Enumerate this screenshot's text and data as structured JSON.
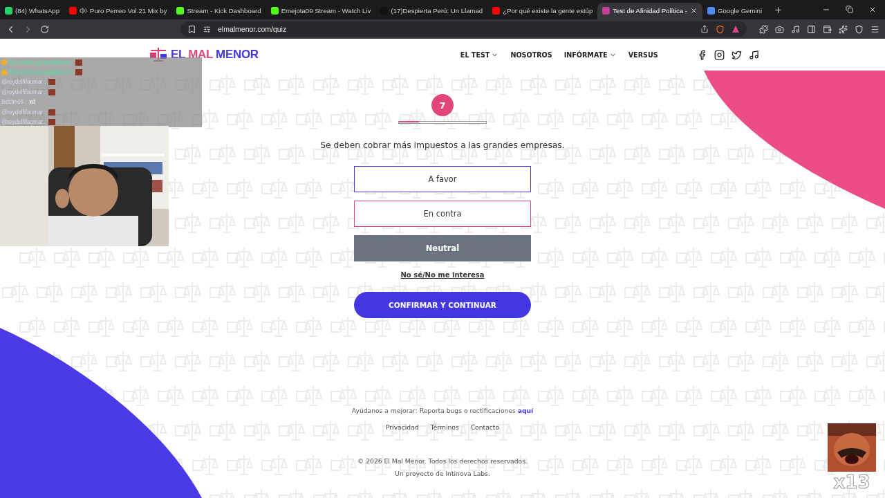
{
  "browser": {
    "tabs": [
      {
        "title": "(84) WhatsApp",
        "kind": "whatsapp",
        "selected": false,
        "audio": false
      },
      {
        "title": "Puro Perreo Vol.21 Mix by",
        "kind": "youtube",
        "selected": false,
        "audio": true
      },
      {
        "title": "Stream - Kick Dashboard",
        "kind": "kick",
        "selected": false,
        "audio": false
      },
      {
        "title": "Emejota09 Stream - Watch Liv",
        "kind": "kick",
        "selected": false,
        "audio": false
      },
      {
        "title": "(17)Despierta Perú: Un Llamad",
        "kind": "tiktok",
        "selected": false,
        "audio": false
      },
      {
        "title": "¿Por qué existe la gente estúp",
        "kind": "youtube",
        "selected": false,
        "audio": false
      },
      {
        "title": "Test de Afinidad Política -",
        "kind": "site",
        "selected": true,
        "audio": false
      },
      {
        "title": "Google Gemini",
        "kind": "gemini",
        "selected": false,
        "audio": false
      }
    ],
    "url": "elmalmenor.com/quiz"
  },
  "header": {
    "logo": {
      "part_1": "EL",
      "part_2": "MAL",
      "part_3": "MENOR"
    },
    "nav": [
      {
        "label": "EL TEST",
        "dropdown": true
      },
      {
        "label": "NOSOTROS",
        "dropdown": false
      },
      {
        "label": "INFÓRMATE",
        "dropdown": true
      },
      {
        "label": "VERSUS",
        "dropdown": false
      }
    ]
  },
  "quiz": {
    "number": "7",
    "level": 0.23,
    "question": "Se deben cobrar más impuestos a las grandes empresas.",
    "answers": [
      {
        "label": "A favor",
        "color": "#4338e0",
        "selected": false
      },
      {
        "label": "En contra",
        "color": "#e0457b",
        "selected": false
      },
      {
        "label": "Neutral",
        "color": "#6b7280",
        "selected": true
      }
    ],
    "skip": "No sé/No me interesa",
    "confirm": "CONFIRMAR Y CONTINUAR"
  },
  "footer": {
    "feedback": "Ayúdanos a mejorar: Reporta bugs o rectificaciones",
    "feedback_link": "aquí",
    "links": [
      "Privacidad",
      "Términos",
      "Contacto"
    ],
    "copyright": "© 2026 El Mal Menor. Todos los derechos reservados.",
    "credit": "Un proyecto de Intinova Labs."
  },
  "overlay": {
    "chat": [
      {
        "user": "ElLocoDeLaCasaBlanca :",
        "badge": true,
        "emote": true
      },
      {
        "user": "ElLocoDeLaCasaBlanca :",
        "badge": true,
        "emote": true
      },
      {
        "user": "@reydelfifaomar :",
        "badge": false,
        "emote": true
      },
      {
        "user": "@reydelfifaomar :",
        "badge": false,
        "emote": true
      },
      {
        "user": "Beldm05 :",
        "badge": false,
        "emote": false,
        "text": "xd"
      },
      {
        "user": "@reydelfifaomar :",
        "badge": false,
        "emote": true
      },
      {
        "user": "@reydelfifaomar :",
        "badge": false,
        "emote": true
      }
    ],
    "combo": "x13"
  }
}
